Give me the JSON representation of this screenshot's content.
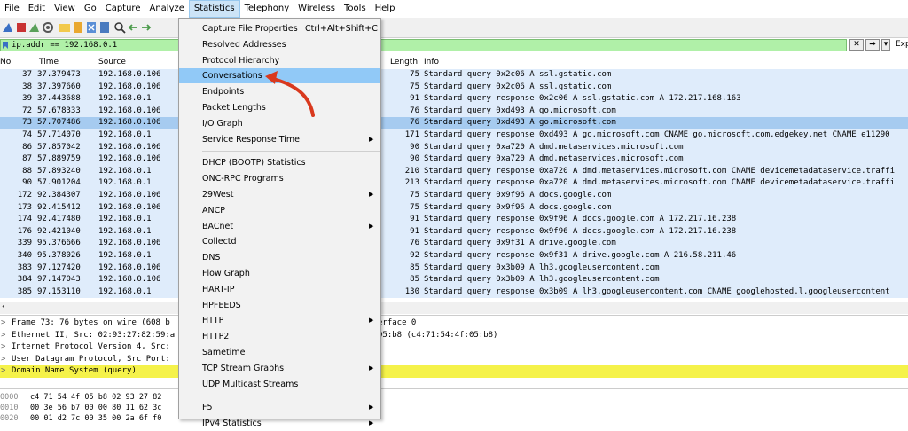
{
  "menubar": {
    "items": [
      "File",
      "Edit",
      "View",
      "Go",
      "Capture",
      "Analyze",
      "Statistics",
      "Telephony",
      "Wireless",
      "Tools",
      "Help"
    ],
    "active_index": 6
  },
  "filter": {
    "value": "ip.addr == 192.168.0.1",
    "expression_label": "Exp"
  },
  "columns": {
    "no": "No.",
    "time": "Time",
    "source": "Source",
    "length": "Length",
    "info": "Info"
  },
  "packets": [
    {
      "no": "37",
      "time": "37.379473",
      "src": "192.168.0.106",
      "len": "75",
      "info": "Standard query 0x2c06 A ssl.gstatic.com"
    },
    {
      "no": "38",
      "time": "37.397660",
      "src": "192.168.0.106",
      "len": "75",
      "info": "Standard query 0x2c06 A ssl.gstatic.com"
    },
    {
      "no": "39",
      "time": "37.443688",
      "src": "192.168.0.1",
      "len": "91",
      "info": "Standard query response 0x2c06 A ssl.gstatic.com A 172.217.168.163"
    },
    {
      "no": "72",
      "time": "57.678333",
      "src": "192.168.0.106",
      "len": "76",
      "info": "Standard query 0xd493 A go.microsoft.com"
    },
    {
      "no": "73",
      "time": "57.707486",
      "src": "192.168.0.106",
      "len": "76",
      "info": "Standard query 0xd493 A go.microsoft.com"
    },
    {
      "no": "74",
      "time": "57.714070",
      "src": "192.168.0.1",
      "len": "171",
      "info": "Standard query response 0xd493 A go.microsoft.com CNAME go.microsoft.com.edgekey.net CNAME e11290"
    },
    {
      "no": "86",
      "time": "57.857042",
      "src": "192.168.0.106",
      "len": "90",
      "info": "Standard query 0xa720 A dmd.metaservices.microsoft.com"
    },
    {
      "no": "87",
      "time": "57.889759",
      "src": "192.168.0.106",
      "len": "90",
      "info": "Standard query 0xa720 A dmd.metaservices.microsoft.com"
    },
    {
      "no": "88",
      "time": "57.893240",
      "src": "192.168.0.1",
      "len": "210",
      "info": "Standard query response 0xa720 A dmd.metaservices.microsoft.com CNAME devicemetadataservice.traffi"
    },
    {
      "no": "90",
      "time": "57.901204",
      "src": "192.168.0.1",
      "len": "213",
      "info": "Standard query response 0xa720 A dmd.metaservices.microsoft.com CNAME devicemetadataservice.traffi"
    },
    {
      "no": "172",
      "time": "92.384307",
      "src": "192.168.0.106",
      "len": "75",
      "info": "Standard query 0x9f96 A docs.google.com"
    },
    {
      "no": "173",
      "time": "92.415412",
      "src": "192.168.0.106",
      "len": "75",
      "info": "Standard query 0x9f96 A docs.google.com"
    },
    {
      "no": "174",
      "time": "92.417480",
      "src": "192.168.0.1",
      "len": "91",
      "info": "Standard query response 0x9f96 A docs.google.com A 172.217.16.238"
    },
    {
      "no": "176",
      "time": "92.421040",
      "src": "192.168.0.1",
      "len": "91",
      "info": "Standard query response 0x9f96 A docs.google.com A 172.217.16.238"
    },
    {
      "no": "339",
      "time": "95.376666",
      "src": "192.168.0.106",
      "len": "76",
      "info": "Standard query 0x9f31 A drive.google.com"
    },
    {
      "no": "340",
      "time": "95.378026",
      "src": "192.168.0.1",
      "len": "92",
      "info": "Standard query response 0x9f31 A drive.google.com A 216.58.211.46"
    },
    {
      "no": "383",
      "time": "97.127420",
      "src": "192.168.0.106",
      "len": "85",
      "info": "Standard query 0x3b09 A lh3.googleusercontent.com"
    },
    {
      "no": "384",
      "time": "97.147043",
      "src": "192.168.0.106",
      "len": "85",
      "info": "Standard query 0x3b09 A lh3.googleusercontent.com"
    },
    {
      "no": "385",
      "time": "97.153110",
      "src": "192.168.0.1",
      "len": "130",
      "info": "Standard query response 0x3b09 A lh3.googleusercontent.com CNAME googlehosted.l.googleusercontent"
    }
  ],
  "selected_packet_index": 4,
  "details": [
    {
      "left": "Frame 73: 76 bytes on wire (608 b",
      "right": "erface 0"
    },
    {
      "left": "Ethernet II, Src: 02:93:27:82:59:a",
      "right": "05:b8 (c4:71:54:4f:05:b8)"
    },
    {
      "left": "Internet Protocol Version 4, Src: ",
      "right": ""
    },
    {
      "left": "User Datagram Protocol, Src Port: ",
      "right": ""
    },
    {
      "left": "Domain Name System (query)",
      "right": ""
    }
  ],
  "hex": [
    {
      "off": "0000",
      "bytes": "c4 71 54 4f 05 b8 02 93  27 82"
    },
    {
      "off": "0010",
      "bytes": "00 3e 56 b7 00 00 80 11  62 3c"
    },
    {
      "off": "0020",
      "bytes": "00 01 d2 7c 00 35 00 2a  6f f0"
    }
  ],
  "statistics_menu": {
    "items": [
      {
        "label": "Capture File Properties",
        "shortcut": "Ctrl+Alt+Shift+C",
        "submenu": false
      },
      {
        "label": "Resolved Addresses",
        "shortcut": "",
        "submenu": false
      },
      {
        "label": "Protocol Hierarchy",
        "shortcut": "",
        "submenu": false
      },
      {
        "label": "Conversations",
        "shortcut": "",
        "submenu": false
      },
      {
        "label": "Endpoints",
        "shortcut": "",
        "submenu": false
      },
      {
        "label": "Packet Lengths",
        "shortcut": "",
        "submenu": false
      },
      {
        "label": "I/O Graph",
        "shortcut": "",
        "submenu": false
      },
      {
        "label": "Service Response Time",
        "shortcut": "",
        "submenu": true
      },
      {
        "separator": true
      },
      {
        "label": "DHCP (BOOTP) Statistics",
        "shortcut": "",
        "submenu": false
      },
      {
        "label": "ONC-RPC Programs",
        "shortcut": "",
        "submenu": false
      },
      {
        "label": "29West",
        "shortcut": "",
        "submenu": true
      },
      {
        "label": "ANCP",
        "shortcut": "",
        "submenu": false
      },
      {
        "label": "BACnet",
        "shortcut": "",
        "submenu": true
      },
      {
        "label": "Collectd",
        "shortcut": "",
        "submenu": false
      },
      {
        "label": "DNS",
        "shortcut": "",
        "submenu": false
      },
      {
        "label": "Flow Graph",
        "shortcut": "",
        "submenu": false
      },
      {
        "label": "HART-IP",
        "shortcut": "",
        "submenu": false
      },
      {
        "label": "HPFEEDS",
        "shortcut": "",
        "submenu": false
      },
      {
        "label": "HTTP",
        "shortcut": "",
        "submenu": true
      },
      {
        "label": "HTTP2",
        "shortcut": "",
        "submenu": false
      },
      {
        "label": "Sametime",
        "shortcut": "",
        "submenu": false
      },
      {
        "label": "TCP Stream Graphs",
        "shortcut": "",
        "submenu": true
      },
      {
        "label": "UDP Multicast Streams",
        "shortcut": "",
        "submenu": false
      },
      {
        "separator": true
      },
      {
        "label": "F5",
        "shortcut": "",
        "submenu": true
      },
      {
        "label": "IPv4 Statistics",
        "shortcut": "",
        "submenu": true
      }
    ],
    "highlighted_index": 3
  },
  "colors": {
    "row_bg": "#dfecfb",
    "row_selected": "#a6cbf0",
    "filter_bg": "#b0f0a8",
    "menu_highlight": "#91c9f7",
    "annotation_arrow": "#d9391e",
    "detail_highlight": "#f5f24a"
  }
}
